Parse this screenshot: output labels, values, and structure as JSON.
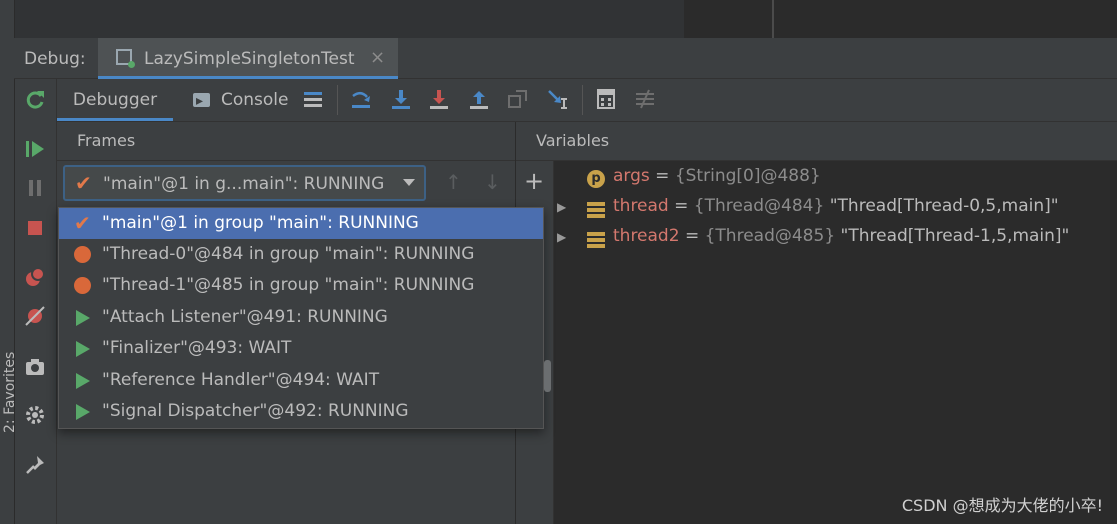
{
  "debug_bar": {
    "label": "Debug:",
    "tab_title": "LazySimpleSingletonTest",
    "tab_close": "×"
  },
  "favorites_strip": {
    "label": "2: Favorites"
  },
  "toolbar": {
    "debugger_tab": "Debugger",
    "console_tab": "Console"
  },
  "frames": {
    "header": "Frames",
    "selected_thread": "\"main\"@1 in g...main\": RUNNING"
  },
  "variables": {
    "header": "Variables",
    "add_button": "+",
    "rows": [
      {
        "icon": "p",
        "name": "args",
        "eq": " = ",
        "type": "{String[0]@488}",
        "value": ""
      },
      {
        "icon": "field",
        "name": "thread",
        "eq": " = ",
        "type": "{Thread@484}",
        "value": " \"Thread[Thread-0,5,main]\""
      },
      {
        "icon": "field",
        "name": "thread2",
        "eq": " = ",
        "type": "{Thread@485}",
        "value": " \"Thread[Thread-1,5,main]\""
      }
    ]
  },
  "thread_list": [
    {
      "icon": "check",
      "label": "\"main\"@1 in group \"main\": RUNNING",
      "selected": true
    },
    {
      "icon": "dot",
      "label": "\"Thread-0\"@484 in group \"main\": RUNNING"
    },
    {
      "icon": "dot",
      "label": "\"Thread-1\"@485 in group \"main\": RUNNING"
    },
    {
      "icon": "play",
      "label": "\"Attach Listener\"@491: RUNNING"
    },
    {
      "icon": "play",
      "label": "\"Finalizer\"@493: WAIT"
    },
    {
      "icon": "play",
      "label": "\"Reference Handler\"@494: WAIT"
    },
    {
      "icon": "play",
      "label": "\"Signal Dispatcher\"@492: RUNNING"
    }
  ],
  "watermark": "CSDN @想成为大佬的小卒!",
  "colors": {
    "accent": "#4a88c7",
    "selection": "#4b6eaf",
    "running_dot": "#d9683a",
    "play_green": "#59a869",
    "field_name": "#d4786e"
  }
}
